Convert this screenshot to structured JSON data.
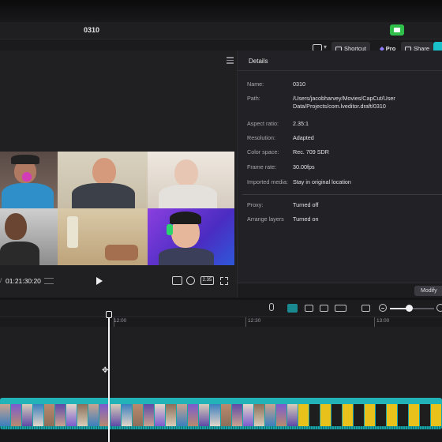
{
  "window": {
    "title": "0310"
  },
  "toolbar": {
    "shortcut_label": "Shortcut",
    "pro_label": "Pro",
    "share_label": "Share"
  },
  "player": {
    "current_time": "01:21:30:20",
    "timecode_prefix": "/",
    "ratio_label": "2.35"
  },
  "details": {
    "header": "Details",
    "rows": [
      {
        "label": "Name:",
        "value": "0310"
      },
      {
        "label": "Path:",
        "value": "/Users/jacobharvey/Movies/CapCut/User Data/Projects/com.lveditor.draft/0310"
      },
      {
        "label": "Aspect ratio:",
        "value": "2.35:1"
      },
      {
        "label": "Resolution:",
        "value": "Adapted"
      },
      {
        "label": "Color space:",
        "value": "Rec. 709 SDR"
      },
      {
        "label": "Frame rate:",
        "value": "30.00fps"
      },
      {
        "label": "Imported media:",
        "value": "Stay in original location"
      },
      {
        "label": "Proxy:",
        "value": "Turned off"
      },
      {
        "label": "Arrange layers",
        "value": "Turned on"
      }
    ],
    "modify_label": "Modify"
  },
  "timeline": {
    "ruler_labels": [
      "12:00",
      "12:30",
      "13:00"
    ],
    "zoom_level": 0.4
  },
  "colors": {
    "accent": "#19c0c9",
    "clip": "#1aa3a7",
    "record": "#2fbf4a"
  },
  "icons": [
    "camera-icon",
    "layout-icon",
    "keyboard-icon",
    "diamond-icon",
    "share-icon",
    "export-icon",
    "menu-icon",
    "play-icon",
    "fullscreen-icon",
    "mic-icon",
    "minus-icon",
    "plus-icon"
  ]
}
